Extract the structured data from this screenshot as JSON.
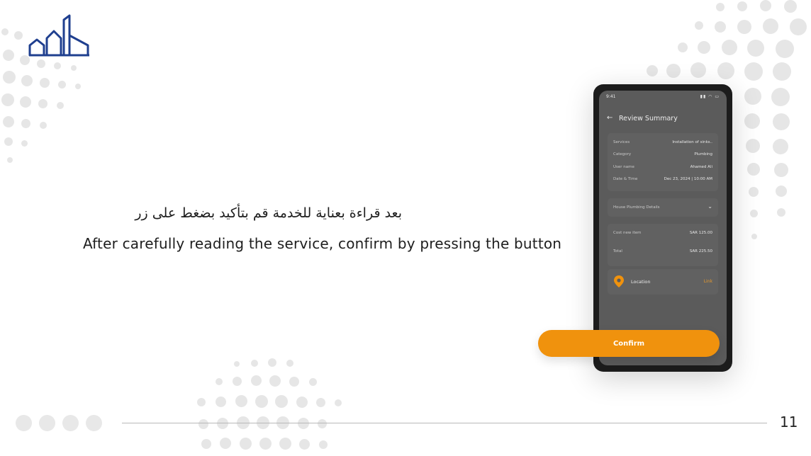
{
  "slide": {
    "headline_ar": "بعد قراءة بعناية للخدمة قم بتأكيد بضغط على زر",
    "headline_en": "After carefully reading the service, confirm by pressing the button",
    "page_number": "11"
  },
  "phone": {
    "status_time": "9:41",
    "status_icons": "▮▮ ◠ ▭",
    "title": "Review Summary",
    "back_icon": "arrow-left-icon",
    "summary": [
      {
        "label": "Services",
        "value": "Installation of sinks.."
      },
      {
        "label": "Category",
        "value": "Plumbing"
      },
      {
        "label": "User name",
        "value": "Ahamed Ali"
      },
      {
        "label": "Date & Time",
        "value": "Dec 23, 2024 | 10:00 AM"
      }
    ],
    "details_label": "House Plumbing Details",
    "costs": [
      {
        "label": "Cost new item",
        "value": "SAR 125.00"
      },
      {
        "label": "Total",
        "value": "SAR 225.50"
      }
    ],
    "location_label": "Location",
    "location_link": "Link"
  },
  "confirm_label": "Confirm",
  "colors": {
    "accent": "#f0920d",
    "logo": "#1f3f8f",
    "screen_bg": "#5b5b5b"
  }
}
